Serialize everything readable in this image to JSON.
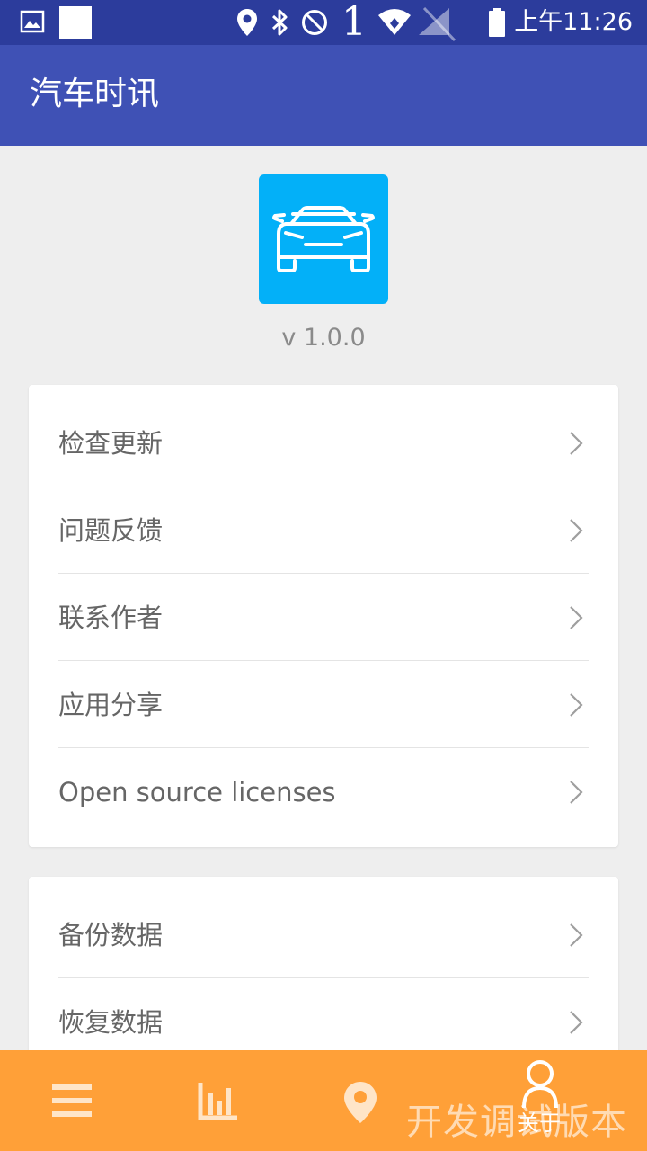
{
  "status_bar": {
    "clock": "上午11:26",
    "signal_digit": "1",
    "icons": [
      "gallery-icon",
      "notification-square-icon",
      "location-icon",
      "bluetooth-icon",
      "do-not-disturb-icon",
      "wifi-icon",
      "no-signal-icon",
      "battery-icon"
    ]
  },
  "toolbar": {
    "title": "汽车时讯"
  },
  "app_info": {
    "logo_icon": "car-icon",
    "logo_color": "#03b0f8",
    "version": "v 1.0.0"
  },
  "menu_group_1": [
    {
      "label": "检查更新"
    },
    {
      "label": "问题反馈"
    },
    {
      "label": "联系作者"
    },
    {
      "label": "应用分享"
    },
    {
      "label": "Open source licenses"
    }
  ],
  "menu_group_2": [
    {
      "label": "备份数据"
    },
    {
      "label": "恢复数据"
    }
  ],
  "bottom_nav": {
    "items": [
      {
        "icon": "menu-icon"
      },
      {
        "icon": "bar-chart-icon"
      },
      {
        "icon": "location-icon"
      },
      {
        "icon": "person-icon",
        "label": "关于",
        "selected": true
      }
    ],
    "background": "#ffa038",
    "watermark": "开发调试版本"
  },
  "colors": {
    "primary": "#3f51b5",
    "status_bar": "#2c3c9c",
    "accent": "#ffa038"
  }
}
